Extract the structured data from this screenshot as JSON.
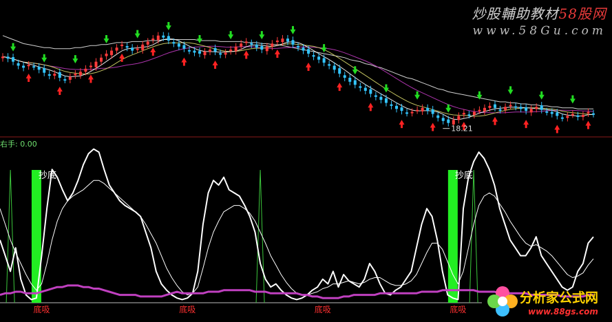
{
  "watermark": {
    "line1": "炒股輔助教材",
    "brand": "58股网",
    "line2": "www.58Gu.com"
  },
  "indicator_label": "右手: 0.00",
  "price_label": "18.21",
  "signal_top_label": "抄底",
  "signal_bottom_label": "底吸",
  "logo": {
    "title": "分析家公式网",
    "url": "www.88gs.com"
  },
  "colors": {
    "up": "#ff3b3b",
    "down": "#33c5ff",
    "up_arrow": "#22dd22",
    "down_arrow": "#ff2222",
    "signal_bar": "#22ee22",
    "pink": "#c040c0",
    "divider": "#8a1a1a"
  },
  "chart_data": [
    {
      "type": "candlestick",
      "title": "",
      "xlabel": "",
      "ylabel": "",
      "n": 115,
      "annotations": [
        {
          "text": "18.21",
          "index": 86
        }
      ],
      "close": [
        25.1,
        24.9,
        24.6,
        24.2,
        24.0,
        24.3,
        24.1,
        23.8,
        23.5,
        23.2,
        23.4,
        23.0,
        22.8,
        23.1,
        23.4,
        23.6,
        23.9,
        24.2,
        24.6,
        25.0,
        25.4,
        25.7,
        26.0,
        26.3,
        26.0,
        25.7,
        25.9,
        26.3,
        26.6,
        26.9,
        27.2,
        27.0,
        26.7,
        26.4,
        26.1,
        25.9,
        25.7,
        25.5,
        25.4,
        25.6,
        25.8,
        25.6,
        25.3,
        25.5,
        25.8,
        26.1,
        26.4,
        26.6,
        26.3,
        26.0,
        25.8,
        26.1,
        26.4,
        26.7,
        26.9,
        26.6,
        26.3,
        26.0,
        25.7,
        25.4,
        25.1,
        24.8,
        24.5,
        24.2,
        23.8,
        23.4,
        23.0,
        22.6,
        22.3,
        22.0,
        21.7,
        21.4,
        21.1,
        20.8,
        20.5,
        20.2,
        19.9,
        19.7,
        19.5,
        19.6,
        19.8,
        20.0,
        19.7,
        19.4,
        19.0,
        18.7,
        18.5,
        18.8,
        19.2,
        19.5,
        19.3,
        19.6,
        19.8,
        20.0,
        20.2,
        20.0,
        19.8,
        20.1,
        20.3,
        20.1,
        19.9,
        19.7,
        19.9,
        20.1,
        19.8,
        19.6,
        19.4,
        19.2,
        19.0,
        19.2,
        19.4,
        19.1,
        19.3,
        19.6,
        19.4
      ],
      "ma_long": [
        27.2,
        27.0,
        26.8,
        26.6,
        26.4,
        26.3,
        26.2,
        26.1,
        26.0,
        26.0,
        25.9,
        25.9,
        25.9,
        25.9,
        26.0,
        26.0,
        26.1,
        26.2,
        26.2,
        26.3,
        26.3,
        26.4,
        26.5,
        26.5,
        26.5,
        26.6,
        26.6,
        26.6,
        26.7,
        26.7,
        26.7,
        26.8,
        26.8,
        26.8,
        26.8,
        26.8,
        26.8,
        26.8,
        26.7,
        26.7,
        26.7,
        26.7,
        26.6,
        26.6,
        26.6,
        26.6,
        26.6,
        26.5,
        26.5,
        26.5,
        26.4,
        26.4,
        26.3,
        26.3,
        26.2,
        26.1,
        26.0,
        25.9,
        25.8,
        25.7,
        25.6,
        25.5,
        25.4,
        25.3,
        25.2,
        25.1,
        25.0,
        24.8,
        24.7,
        24.6,
        24.4,
        24.3,
        24.1,
        24.0,
        23.8,
        23.6,
        23.4,
        23.2,
        23.0,
        22.9,
        22.7,
        22.5,
        22.3,
        22.1,
        21.9,
        21.8,
        21.6,
        21.5,
        21.4,
        21.3,
        21.2,
        21.1,
        21.0,
        20.9,
        20.8,
        20.7,
        20.6,
        20.6,
        20.5,
        20.5,
        20.4,
        20.4,
        20.3,
        20.3,
        20.2,
        20.2,
        20.1,
        20.1,
        20.0,
        20.0,
        20.0,
        19.9,
        19.9,
        19.9,
        19.9
      ]
    },
    {
      "type": "line",
      "title": "",
      "xlabel": "",
      "ylabel": "",
      "ylim": [
        0,
        100
      ],
      "n": 115,
      "signal_indices": [
        7,
        87
      ],
      "bottom_label_indices": [
        8,
        36,
        62,
        88
      ],
      "spike_indices": [
        2,
        50,
        91
      ],
      "series": [
        {
          "values": [
            40,
            30,
            20,
            35,
            15,
            5,
            2,
            3,
            30,
            60,
            85,
            80,
            72,
            65,
            70,
            78,
            88,
            95,
            98,
            96,
            85,
            75,
            70,
            65,
            62,
            60,
            58,
            55,
            45,
            35,
            20,
            12,
            8,
            5,
            3,
            2,
            3,
            6,
            20,
            50,
            70,
            78,
            75,
            80,
            72,
            70,
            68,
            62,
            55,
            45,
            25,
            15,
            10,
            12,
            8,
            5,
            3,
            2,
            3,
            5,
            8,
            10,
            15,
            12,
            20,
            10,
            18,
            14,
            12,
            10,
            15,
            25,
            20,
            12,
            6,
            5,
            8,
            10,
            15,
            20,
            35,
            50,
            60,
            55,
            40,
            20,
            5,
            3,
            2,
            60,
            80,
            90,
            96,
            92,
            85,
            75,
            60,
            50,
            40,
            35,
            30,
            30,
            35,
            42,
            30,
            25,
            20,
            15,
            10,
            8,
            10,
            20,
            25,
            38,
            42
          ]
        },
        {
          "values": [
            60,
            50,
            40,
            32,
            25,
            18,
            12,
            8,
            12,
            25,
            40,
            52,
            60,
            65,
            68,
            70,
            72,
            75,
            78,
            78,
            76,
            73,
            70,
            67,
            64,
            61,
            58,
            55,
            50,
            44,
            38,
            30,
            22,
            16,
            11,
            7,
            5,
            6,
            10,
            22,
            35,
            45,
            52,
            58,
            60,
            62,
            62,
            60,
            57,
            52,
            45,
            38,
            30,
            24,
            18,
            13,
            9,
            6,
            5,
            5,
            6,
            7,
            9,
            10,
            12,
            12,
            13,
            14,
            13,
            12,
            13,
            15,
            16,
            16,
            14,
            12,
            11,
            11,
            12,
            14,
            18,
            25,
            32,
            38,
            38,
            34,
            26,
            18,
            12,
            20,
            35,
            50,
            62,
            68,
            70,
            68,
            63,
            58,
            52,
            47,
            42,
            38,
            36,
            37,
            35,
            33,
            30,
            26,
            22,
            18,
            16,
            17,
            19,
            24,
            28
          ]
        },
        {
          "values": [
            5,
            6,
            6,
            7,
            7,
            6,
            6,
            6,
            7,
            8,
            9,
            10,
            10,
            11,
            11,
            11,
            10,
            10,
            9,
            9,
            8,
            7,
            6,
            5,
            5,
            5,
            5,
            4,
            4,
            4,
            4,
            4,
            5,
            6,
            7,
            6,
            6,
            6,
            6,
            6,
            7,
            7,
            7,
            8,
            8,
            8,
            8,
            8,
            8,
            7,
            7,
            7,
            6,
            6,
            6,
            6,
            6,
            6,
            5,
            5,
            4,
            4,
            3,
            3,
            3,
            3,
            4,
            4,
            5,
            5,
            5,
            5,
            5,
            6,
            6,
            6,
            6,
            6,
            6,
            6,
            6,
            7,
            7,
            7,
            7,
            8,
            8,
            8,
            8,
            8,
            8,
            8,
            7,
            7,
            7,
            7,
            6,
            6,
            6,
            6,
            6,
            6,
            5,
            5,
            5,
            5,
            5,
            5,
            4,
            4,
            4,
            4,
            4,
            5,
            5
          ]
        }
      ]
    }
  ]
}
